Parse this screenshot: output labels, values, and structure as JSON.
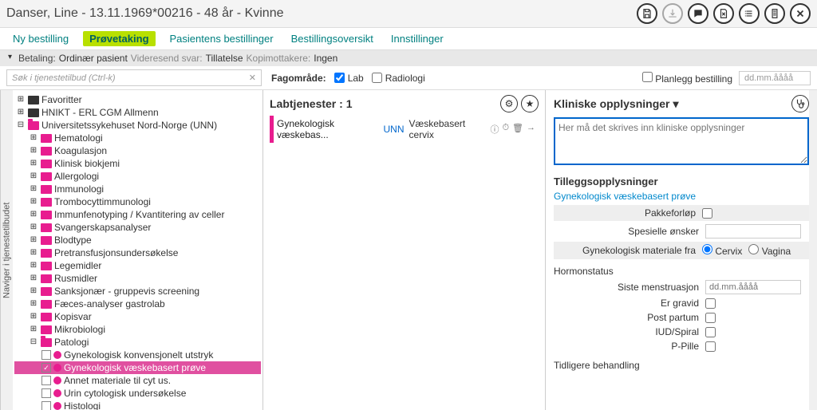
{
  "header": {
    "title": "Danser, Line - 13.11.1969*00216 - 48 år - Kvinne"
  },
  "tabs": [
    {
      "label": "Ny bestilling",
      "active": false
    },
    {
      "label": "Prøvetaking",
      "active": true
    },
    {
      "label": "Pasientens bestillinger",
      "active": false
    },
    {
      "label": "Bestillingsoversikt",
      "active": false
    },
    {
      "label": "Innstillinger",
      "active": false
    }
  ],
  "infobar": {
    "betaling_label": "Betaling:",
    "betaling_value": "Ordinær pasient",
    "videresend_label": "Videresend svar:",
    "videresend_value": "Tillatelse",
    "kopi_label": "Kopimottakere:",
    "kopi_value": "Ingen"
  },
  "filterbar": {
    "search_placeholder": "Søk i tjenestetilbud (Ctrl-k)",
    "fagomrade_label": "Fagområde:",
    "lab_label": "Lab",
    "radiologi_label": "Radiologi",
    "planlegg_label": "Planlegg bestilling",
    "date_placeholder": "dd.mm.åååå"
  },
  "sidebar_label": "Naviger i tjenestetilbudet",
  "tree": {
    "favoritter": "Favoritter",
    "hnikt": "HNIKT - ERL CGM Allmenn",
    "unn": "Universitetssykehuset Nord-Norge (UNN)",
    "children": [
      "Hematologi",
      "Koagulasjon",
      "Klinisk biokjemi",
      "Allergologi",
      "Immunologi",
      "Trombocyttimmunologi",
      "Immunfenotyping / Kvantitering av celler",
      "Svangerskapsanalyser",
      "Blodtype",
      "Pretransfusjonsundersøkelse",
      "Legemidler",
      "Rusmidler",
      "Sanksjonær - gruppevis screening",
      "Fæces-analyser gastrolab",
      "Kopisvar",
      "Mikrobiologi"
    ],
    "patologi": "Patologi",
    "patologi_children": [
      {
        "label": "Gynekologisk konvensjonelt utstryk",
        "checked": false,
        "selected": false
      },
      {
        "label": "Gynekologisk væskebasert prøve",
        "checked": true,
        "selected": true
      },
      {
        "label": "Annet materiale til cyt us.",
        "checked": false,
        "selected": false
      },
      {
        "label": "Urin cytologisk undersøkelse",
        "checked": false,
        "selected": false
      },
      {
        "label": "Histologi",
        "checked": false,
        "selected": false
      }
    ]
  },
  "center": {
    "title": "Labtjenester : 1",
    "item": {
      "name": "Gynekologisk væskebas...",
      "org": "UNN",
      "desc": "Væskebasert cervix"
    }
  },
  "right": {
    "clinical_title": "Kliniske opplysninger",
    "clinical_placeholder": "Her må det skrives inn kliniske opplysninger",
    "additional_title": "Tilleggsopplysninger",
    "link": "Gynekologisk væskebasert prøve",
    "pakkeforlop": "Pakkeforløp",
    "spesielle": "Spesielle ønsker",
    "gyn_mat": "Gynekologisk materiale fra",
    "cervix": "Cervix",
    "vagina": "Vagina",
    "hormonstatus": "Hormonstatus",
    "siste_mens": "Siste menstruasjon",
    "date_ph": "dd.mm.åååå",
    "gravid": "Er gravid",
    "postpartum": "Post partum",
    "iud": "IUD/Spiral",
    "ppille": "P-Pille",
    "tidligere": "Tidligere behandling"
  }
}
